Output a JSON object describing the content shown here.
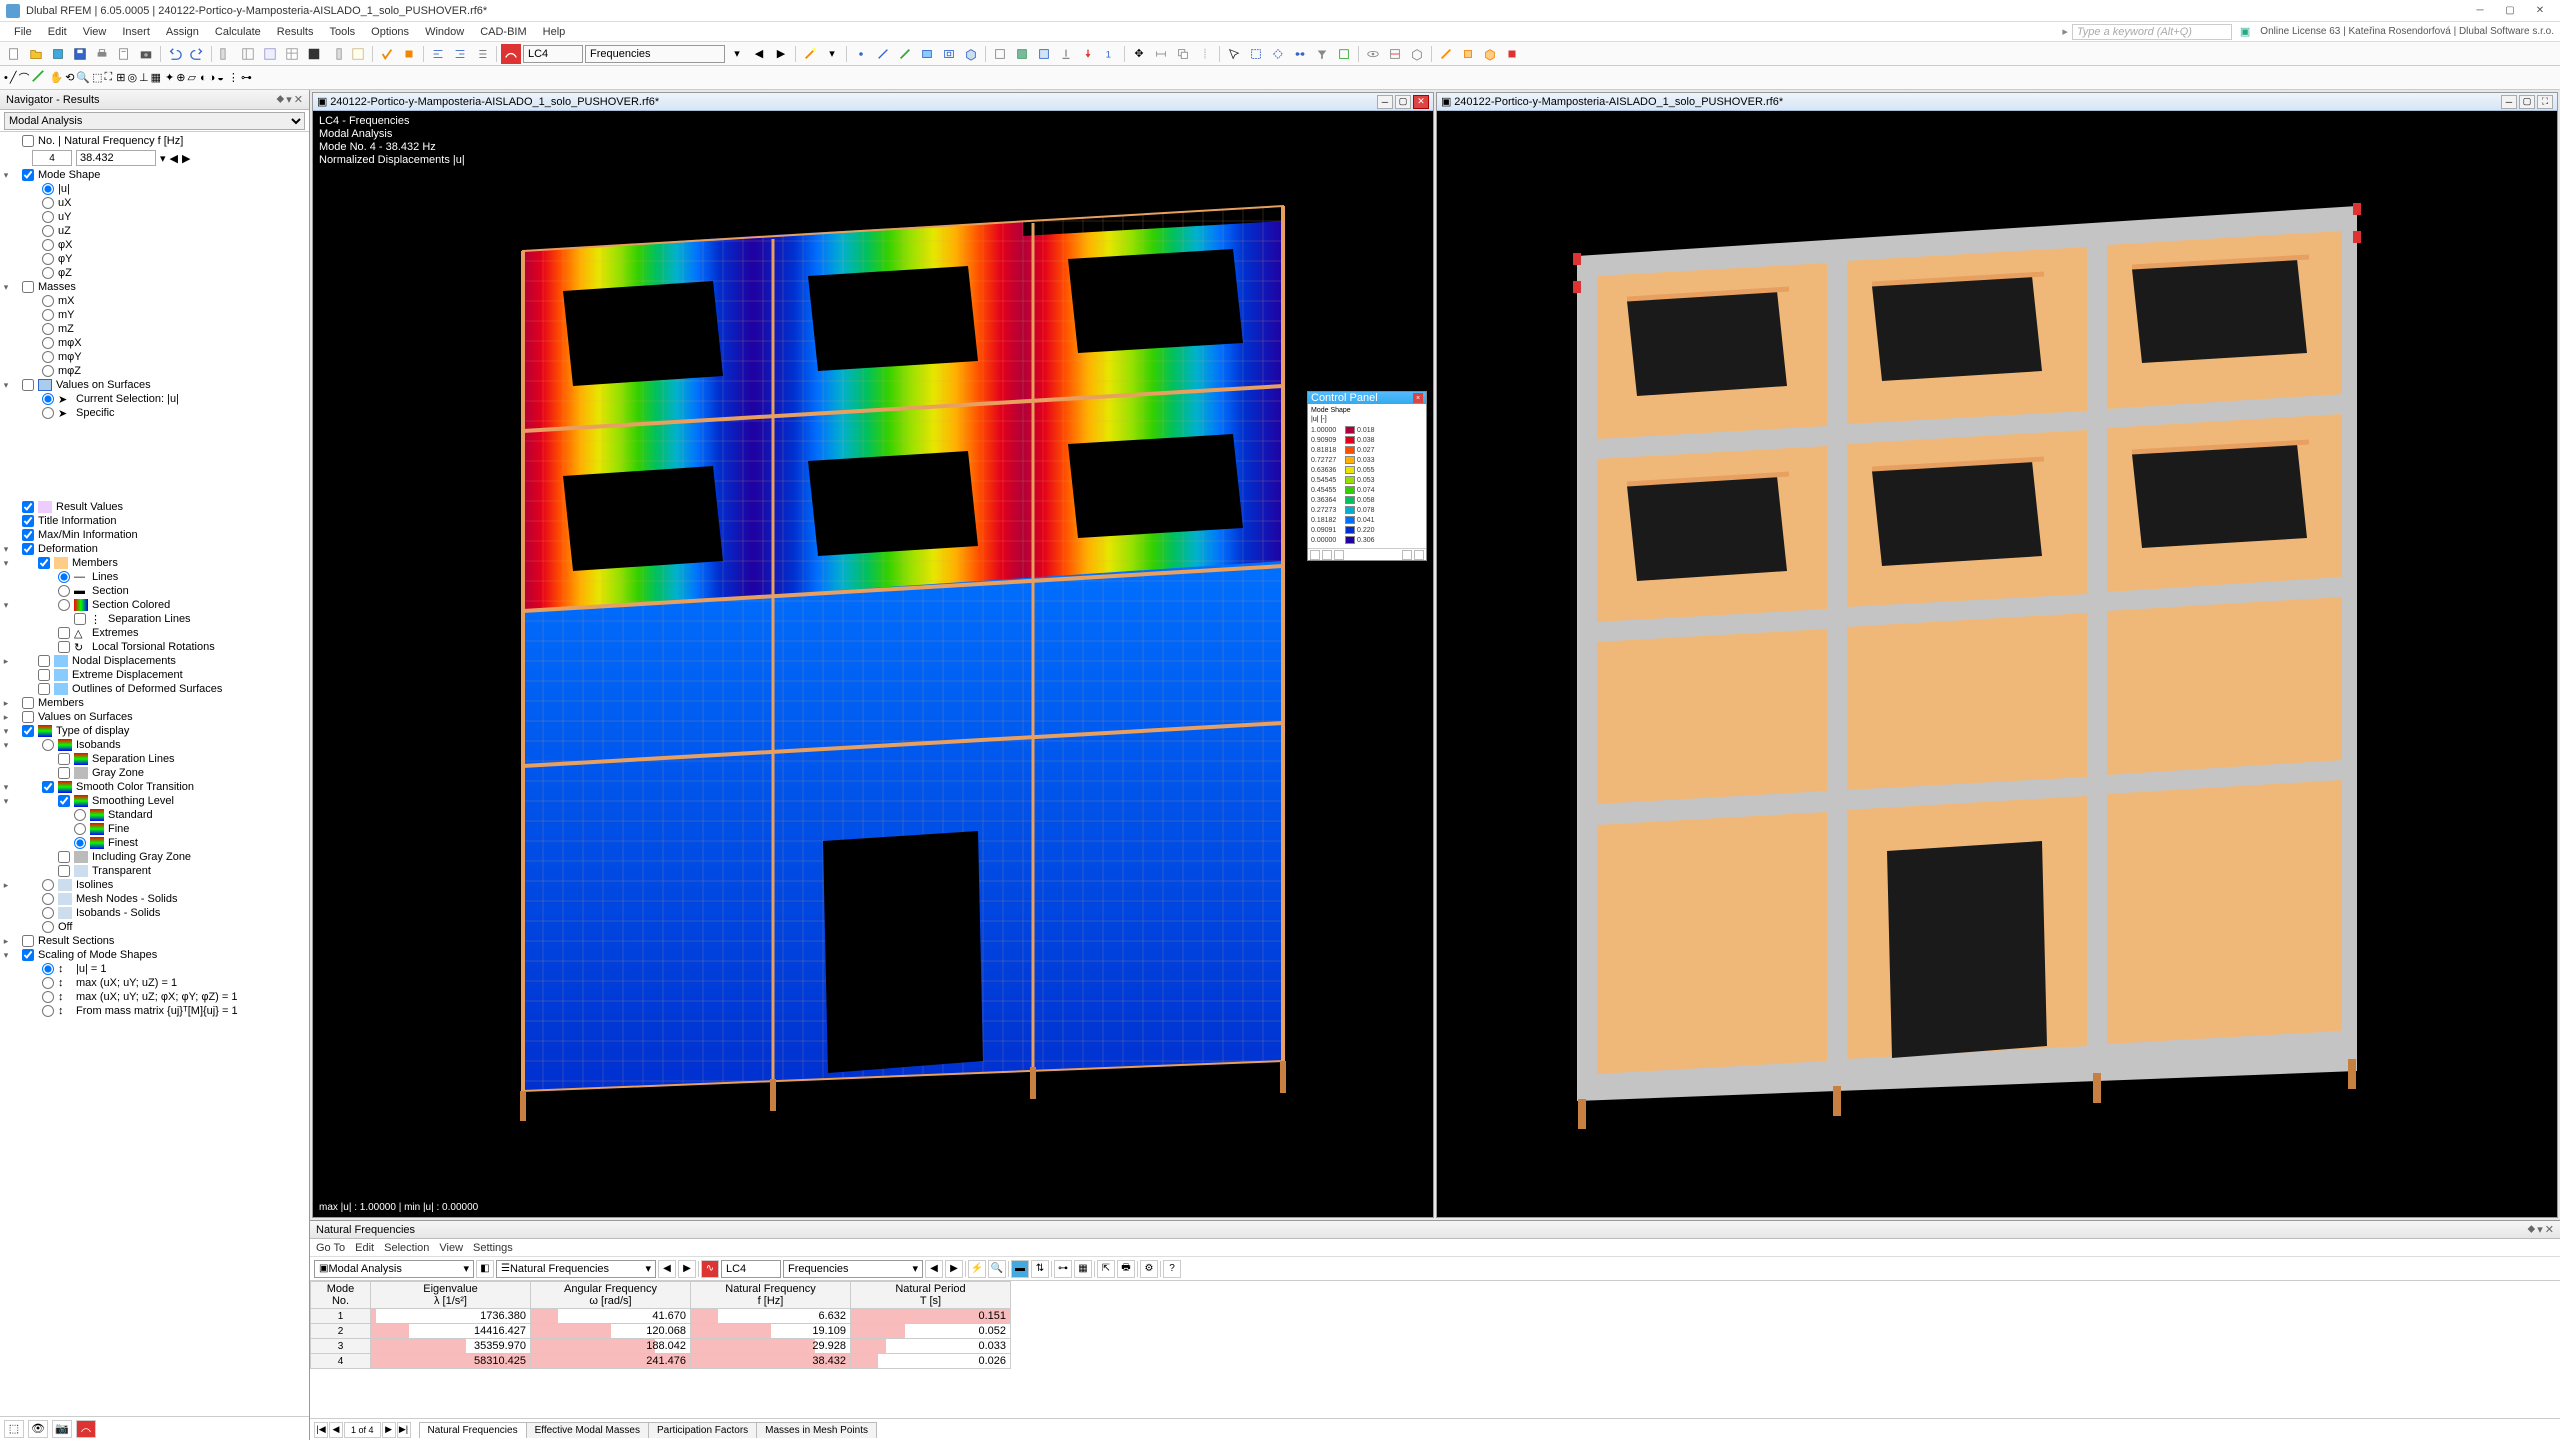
{
  "app": {
    "title": "Dlubal RFEM | 6.05.0005 | 240122-Portico-y-Mamposteria-AISLADO_1_solo_PUSHOVER.rf6*",
    "search_placeholder": "Type a keyword (Alt+Q)",
    "license": "Online License 63 | Kateřina Rosendorfová | Dlubal Software s.r.o."
  },
  "menu": [
    "File",
    "Edit",
    "View",
    "Insert",
    "Assign",
    "Calculate",
    "Results",
    "Tools",
    "Options",
    "Window",
    "CAD-BIM",
    "Help"
  ],
  "lc": {
    "code": "LC4",
    "name": "Frequencies"
  },
  "navigator": {
    "title": "Navigator - Results",
    "dropdown": "Modal Analysis",
    "freq_header": "No. | Natural Frequency f [Hz]",
    "freq_no": "4",
    "freq_val": "38.432",
    "groups": {
      "mode_shape": "Mode Shape",
      "u": "|u|",
      "ux": "uX",
      "uy": "uY",
      "uz": "uZ",
      "phix": "φX",
      "phiy": "φY",
      "phiz": "φZ",
      "masses": "Masses",
      "mx": "mX",
      "my": "mY",
      "mz": "mZ",
      "mphix": "mφX",
      "mphiy": "mφY",
      "mphiz": "mφZ",
      "values_on_surfaces": "Values on Surfaces",
      "current_selection": "Current Selection: |u|",
      "specific": "Specific",
      "result_values": "Result Values",
      "title_info": "Title Information",
      "maxmin": "Max/Min Information",
      "deformation": "Deformation",
      "members": "Members",
      "lines": "Lines",
      "section": "Section",
      "section_colored": "Section Colored",
      "separation_lines": "Separation Lines",
      "extremes": "Extremes",
      "local_torsional": "Local Torsional Rotations",
      "nodal_disp": "Nodal Displacements",
      "extreme_disp": "Extreme Displacement",
      "outlines": "Outlines of Deformed Surfaces",
      "members2": "Members",
      "values_on_surfaces2": "Values on Surfaces",
      "type_display": "Type of display",
      "isobands": "Isobands",
      "separation_lines2": "Separation Lines",
      "gray_zone": "Gray Zone",
      "smooth_color": "Smooth Color Transition",
      "smoothing_level": "Smoothing Level",
      "standard": "Standard",
      "fine": "Fine",
      "finest": "Finest",
      "including_gray": "Including Gray Zone",
      "transparent": "Transparent",
      "isolines": "Isolines",
      "mesh_nodes": "Mesh Nodes - Solids",
      "isobands_solids": "Isobands - Solids",
      "off": "Off",
      "result_sections": "Result Sections",
      "scaling": "Scaling of Mode Shapes",
      "scale_u1": "|u| = 1",
      "scale_max1": "max (uX; uY; uZ) = 1",
      "scale_max2": "max (uX; uY; uZ; φX; φY; φZ) = 1",
      "scale_mass": "From mass matrix {uj}ᵀ[M]{uj} = 1"
    }
  },
  "view": {
    "doc_title": "240122-Portico-y-Mamposteria-AISLADO_1_solo_PUSHOVER.rf6*",
    "info_line1": "LC4 - Frequencies",
    "info_line2": "Modal Analysis",
    "info_line3": "Mode No. 4 - 38.432 Hz",
    "info_line4": "Normalized Displacements |u|",
    "status": "max |u| : 1.00000 | min |u| : 0.00000"
  },
  "control_panel": {
    "title": "Control Panel",
    "subtitle": "Mode Shape",
    "sub2": "|u| [-]",
    "rows": [
      {
        "v": "1.00000",
        "c": "#b0003a",
        "v2": "0.018"
      },
      {
        "v": "0.90909",
        "c": "#e3001b",
        "v2": "0.038"
      },
      {
        "v": "0.81818",
        "c": "#ff4d00",
        "v2": "0.027"
      },
      {
        "v": "0.72727",
        "c": "#ffb000",
        "v2": "0.033"
      },
      {
        "v": "0.63636",
        "c": "#e6e600",
        "v2": "0.055"
      },
      {
        "v": "0.54545",
        "c": "#95e000",
        "v2": "0.053"
      },
      {
        "v": "0.45455",
        "c": "#33d000",
        "v2": "0.074"
      },
      {
        "v": "0.36364",
        "c": "#00c060",
        "v2": "0.058"
      },
      {
        "v": "0.27273",
        "c": "#00b0d0",
        "v2": "0.078"
      },
      {
        "v": "0.18182",
        "c": "#0070ff",
        "v2": "0.041"
      },
      {
        "v": "0.09091",
        "c": "#0030d0",
        "v2": "0.220"
      },
      {
        "v": "0.00000",
        "c": "#2000a0",
        "v2": "0.306"
      }
    ]
  },
  "results": {
    "title": "Natural Frequencies",
    "menu": [
      "Go To",
      "Edit",
      "Selection",
      "View",
      "Settings"
    ],
    "dropdown1": "Modal Analysis",
    "dropdown2": "Natural Frequencies",
    "lc_code": "LC4",
    "lc_name": "Frequencies",
    "headers": {
      "mode": "Mode\nNo.",
      "eigen": "Eigenvalue\nλ [1/s²]",
      "ang": "Angular Frequency\nω [rad/s]",
      "nat": "Natural Frequency\nf [Hz]",
      "per": "Natural Period\nT [s]"
    },
    "rows": [
      {
        "no": 1,
        "eigen": "1736.380",
        "ang": "41.670",
        "nat": "6.632",
        "per": "0.151",
        "b": [
          3,
          17,
          17,
          100
        ]
      },
      {
        "no": 2,
        "eigen": "14416.427",
        "ang": "120.068",
        "nat": "19.109",
        "per": "0.052",
        "b": [
          24,
          50,
          50,
          34
        ]
      },
      {
        "no": 3,
        "eigen": "35359.970",
        "ang": "188.042",
        "nat": "29.928",
        "per": "0.033",
        "b": [
          60,
          78,
          78,
          22
        ]
      },
      {
        "no": 4,
        "eigen": "58310.425",
        "ang": "241.476",
        "nat": "38.432",
        "per": "0.026",
        "b": [
          100,
          100,
          100,
          17
        ]
      }
    ],
    "pager": "1 of 4",
    "tabs": [
      "Natural Frequencies",
      "Effective Modal Masses",
      "Participation Factors",
      "Masses in Mesh Points"
    ]
  }
}
